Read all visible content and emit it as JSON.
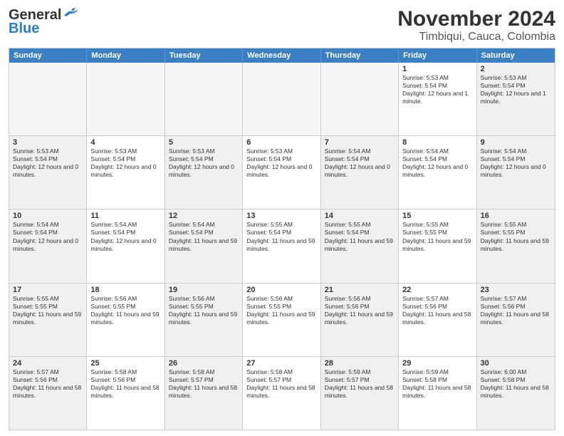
{
  "header": {
    "logo_line1": "General",
    "logo_line2": "Blue",
    "title": "November 2024",
    "subtitle": "Timbiqui, Cauca, Colombia"
  },
  "calendar": {
    "days_of_week": [
      "Sunday",
      "Monday",
      "Tuesday",
      "Wednesday",
      "Thursday",
      "Friday",
      "Saturday"
    ],
    "weeks": [
      [
        {
          "day": "",
          "empty": true
        },
        {
          "day": "",
          "empty": true
        },
        {
          "day": "",
          "empty": true
        },
        {
          "day": "",
          "empty": true
        },
        {
          "day": "",
          "empty": true
        },
        {
          "day": "1",
          "sunrise": "5:53 AM",
          "sunset": "5:54 PM",
          "daylight": "12 hours and 1 minute."
        },
        {
          "day": "2",
          "sunrise": "5:53 AM",
          "sunset": "5:54 PM",
          "daylight": "12 hours and 1 minute."
        }
      ],
      [
        {
          "day": "3",
          "sunrise": "5:53 AM",
          "sunset": "5:54 PM",
          "daylight": "12 hours and 0 minutes."
        },
        {
          "day": "4",
          "sunrise": "5:53 AM",
          "sunset": "5:54 PM",
          "daylight": "12 hours and 0 minutes."
        },
        {
          "day": "5",
          "sunrise": "5:53 AM",
          "sunset": "5:54 PM",
          "daylight": "12 hours and 0 minutes."
        },
        {
          "day": "6",
          "sunrise": "5:53 AM",
          "sunset": "5:54 PM",
          "daylight": "12 hours and 0 minutes."
        },
        {
          "day": "7",
          "sunrise": "5:54 AM",
          "sunset": "5:54 PM",
          "daylight": "12 hours and 0 minutes."
        },
        {
          "day": "8",
          "sunrise": "5:54 AM",
          "sunset": "5:54 PM",
          "daylight": "12 hours and 0 minutes."
        },
        {
          "day": "9",
          "sunrise": "5:54 AM",
          "sunset": "5:54 PM",
          "daylight": "12 hours and 0 minutes."
        }
      ],
      [
        {
          "day": "10",
          "sunrise": "5:54 AM",
          "sunset": "5:54 PM",
          "daylight": "12 hours and 0 minutes."
        },
        {
          "day": "11",
          "sunrise": "5:54 AM",
          "sunset": "5:54 PM",
          "daylight": "12 hours and 0 minutes."
        },
        {
          "day": "12",
          "sunrise": "5:54 AM",
          "sunset": "5:54 PM",
          "daylight": "11 hours and 59 minutes."
        },
        {
          "day": "13",
          "sunrise": "5:55 AM",
          "sunset": "5:54 PM",
          "daylight": "11 hours and 59 minutes."
        },
        {
          "day": "14",
          "sunrise": "5:55 AM",
          "sunset": "5:54 PM",
          "daylight": "11 hours and 59 minutes."
        },
        {
          "day": "15",
          "sunrise": "5:55 AM",
          "sunset": "5:55 PM",
          "daylight": "11 hours and 59 minutes."
        },
        {
          "day": "16",
          "sunrise": "5:55 AM",
          "sunset": "5:55 PM",
          "daylight": "11 hours and 59 minutes."
        }
      ],
      [
        {
          "day": "17",
          "sunrise": "5:55 AM",
          "sunset": "5:55 PM",
          "daylight": "11 hours and 59 minutes."
        },
        {
          "day": "18",
          "sunrise": "5:56 AM",
          "sunset": "5:55 PM",
          "daylight": "11 hours and 59 minutes."
        },
        {
          "day": "19",
          "sunrise": "5:56 AM",
          "sunset": "5:55 PM",
          "daylight": "11 hours and 59 minutes."
        },
        {
          "day": "20",
          "sunrise": "5:56 AM",
          "sunset": "5:55 PM",
          "daylight": "11 hours and 59 minutes."
        },
        {
          "day": "21",
          "sunrise": "5:56 AM",
          "sunset": "5:56 PM",
          "daylight": "11 hours and 59 minutes."
        },
        {
          "day": "22",
          "sunrise": "5:57 AM",
          "sunset": "5:56 PM",
          "daylight": "11 hours and 58 minutes."
        },
        {
          "day": "23",
          "sunrise": "5:57 AM",
          "sunset": "5:56 PM",
          "daylight": "11 hours and 58 minutes."
        }
      ],
      [
        {
          "day": "24",
          "sunrise": "5:57 AM",
          "sunset": "5:56 PM",
          "daylight": "11 hours and 58 minutes."
        },
        {
          "day": "25",
          "sunrise": "5:58 AM",
          "sunset": "5:56 PM",
          "daylight": "11 hours and 58 minutes."
        },
        {
          "day": "26",
          "sunrise": "5:58 AM",
          "sunset": "5:57 PM",
          "daylight": "11 hours and 58 minutes."
        },
        {
          "day": "27",
          "sunrise": "5:58 AM",
          "sunset": "5:57 PM",
          "daylight": "11 hours and 58 minutes."
        },
        {
          "day": "28",
          "sunrise": "5:59 AM",
          "sunset": "5:57 PM",
          "daylight": "11 hours and 58 minutes."
        },
        {
          "day": "29",
          "sunrise": "5:59 AM",
          "sunset": "5:58 PM",
          "daylight": "11 hours and 58 minutes."
        },
        {
          "day": "30",
          "sunrise": "6:00 AM",
          "sunset": "5:58 PM",
          "daylight": "11 hours and 58 minutes."
        }
      ]
    ]
  },
  "labels": {
    "sunrise": "Sunrise:",
    "sunset": "Sunset:",
    "daylight": "Daylight:"
  }
}
